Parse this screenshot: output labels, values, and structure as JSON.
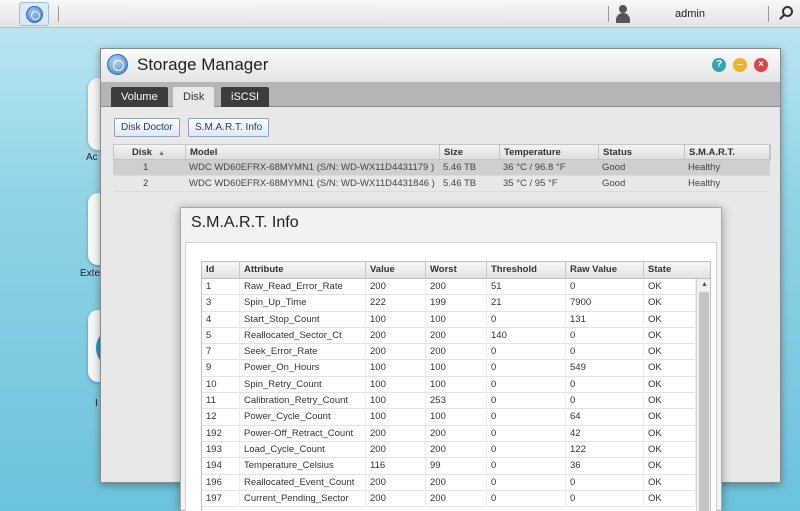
{
  "taskbar": {
    "user": "admin"
  },
  "desktop": {
    "labels": [
      "Ac",
      "Exte",
      "I"
    ]
  },
  "window": {
    "title": "Storage Manager",
    "tabs": [
      "Volume",
      "Disk",
      "iSCSI"
    ],
    "active_tab": "Disk",
    "buttons": {
      "disk_doctor": "Disk Doctor",
      "smart_info": "S.M.A.R.T. Info"
    },
    "disk_table": {
      "columns": [
        "Disk",
        "Model",
        "Size",
        "Temperature",
        "Status",
        "S.M.A.R.T."
      ],
      "rows": [
        [
          "1",
          "WDC WD60EFRX-68MYMN1 (S/N: WD-WX11D4431179 )",
          "5.46 TB",
          "36 °C / 96.8 °F",
          "Good",
          "Healthy"
        ],
        [
          "2",
          "WDC WD60EFRX-68MYMN1 (S/N: WD-WX11D4431846 )",
          "5.46 TB",
          "35 °C / 95 °F",
          "Good",
          "Healthy"
        ]
      ]
    }
  },
  "smart_dialog": {
    "title": "S.M.A.R.T. Info",
    "columns": [
      "Id",
      "Attribute",
      "Value",
      "Worst",
      "Threshold",
      "Raw Value",
      "State"
    ],
    "rows": [
      [
        "1",
        "Raw_Read_Error_Rate",
        "200",
        "200",
        "51",
        "0",
        "OK"
      ],
      [
        "3",
        "Spin_Up_Time",
        "222",
        "199",
        "21",
        "7900",
        "OK"
      ],
      [
        "4",
        "Start_Stop_Count",
        "100",
        "100",
        "0",
        "131",
        "OK"
      ],
      [
        "5",
        "Reallocated_Sector_Ct",
        "200",
        "200",
        "140",
        "0",
        "OK"
      ],
      [
        "7",
        "Seek_Error_Rate",
        "200",
        "200",
        "0",
        "0",
        "OK"
      ],
      [
        "9",
        "Power_On_Hours",
        "100",
        "100",
        "0",
        "549",
        "OK"
      ],
      [
        "10",
        "Spin_Retry_Count",
        "100",
        "100",
        "0",
        "0",
        "OK"
      ],
      [
        "11",
        "Calibration_Retry_Count",
        "100",
        "253",
        "0",
        "0",
        "OK"
      ],
      [
        "12",
        "Power_Cycle_Count",
        "100",
        "100",
        "0",
        "64",
        "OK"
      ],
      [
        "192",
        "Power-Off_Retract_Count",
        "200",
        "200",
        "0",
        "42",
        "OK"
      ],
      [
        "193",
        "Load_Cycle_Count",
        "200",
        "200",
        "0",
        "122",
        "OK"
      ],
      [
        "194",
        "Temperature_Celsius",
        "116",
        "99",
        "0",
        "36",
        "OK"
      ],
      [
        "196",
        "Reallocated_Event_Count",
        "200",
        "200",
        "0",
        "0",
        "OK"
      ],
      [
        "197",
        "Current_Pending_Sector",
        "200",
        "200",
        "0",
        "0",
        "OK"
      ]
    ]
  }
}
